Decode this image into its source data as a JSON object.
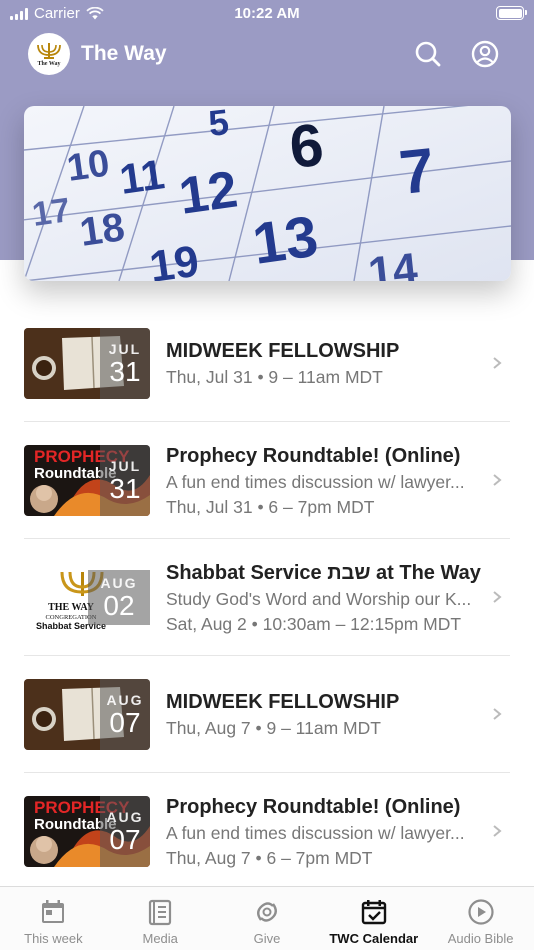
{
  "status_bar": {
    "carrier": "Carrier",
    "time": "10:22 AM"
  },
  "app_bar": {
    "title": "The Way",
    "logo_text": "The Way"
  },
  "banner": {
    "numbers": [
      "5",
      "6",
      "7",
      "10",
      "11",
      "12",
      "13",
      "17",
      "18",
      "19",
      "14"
    ]
  },
  "events": [
    {
      "title": "MIDWEEK FELLOWSHIP",
      "description": "",
      "when": "Thu, Jul 31 • 9 – 11am MDT",
      "month": "JUL",
      "day": "31",
      "thumb": "fellowship"
    },
    {
      "title": "Prophecy Roundtable! (Online)",
      "description": "A fun end times discussion w/ lawyer...",
      "when": "Thu, Jul 31 • 6 – 7pm MDT",
      "month": "JUL",
      "day": "31",
      "thumb": "prophecy",
      "thumb_text": [
        "PROPHECY",
        "Roundtable"
      ]
    },
    {
      "title": "Shabbat Service שבת at The Way",
      "description": "Study God's Word and Worship our K...",
      "when": "Sat, Aug 2 • 10:30am – 12:15pm MDT",
      "month": "AUG",
      "day": "02",
      "thumb": "shabbat",
      "thumb_text": [
        "THE WAY",
        "CONGREGATION",
        "Shabbat Service"
      ]
    },
    {
      "title": "MIDWEEK FELLOWSHIP",
      "description": "",
      "when": "Thu, Aug 7 • 9 – 11am MDT",
      "month": "AUG",
      "day": "07",
      "thumb": "fellowship"
    },
    {
      "title": "Prophecy Roundtable! (Online)",
      "description": "A fun end times discussion w/ lawyer...",
      "when": "Thu, Aug 7 • 6 – 7pm MDT",
      "month": "AUG",
      "day": "07",
      "thumb": "prophecy",
      "thumb_text": [
        "PROPHECY",
        "Roundtable"
      ]
    }
  ],
  "tabs": [
    {
      "label": "This week",
      "icon": "calendar-icon",
      "active": false
    },
    {
      "label": "Media",
      "icon": "book-icon",
      "active": false
    },
    {
      "label": "Give",
      "icon": "give-icon",
      "active": false
    },
    {
      "label": "TWC Calendar",
      "icon": "calendar-check-icon",
      "active": true
    },
    {
      "label": "Audio Bible",
      "icon": "play-circle-icon",
      "active": false
    }
  ],
  "colors": {
    "header": "#9b9bc4",
    "accent": "#111111",
    "muted": "#8e8e8e"
  }
}
